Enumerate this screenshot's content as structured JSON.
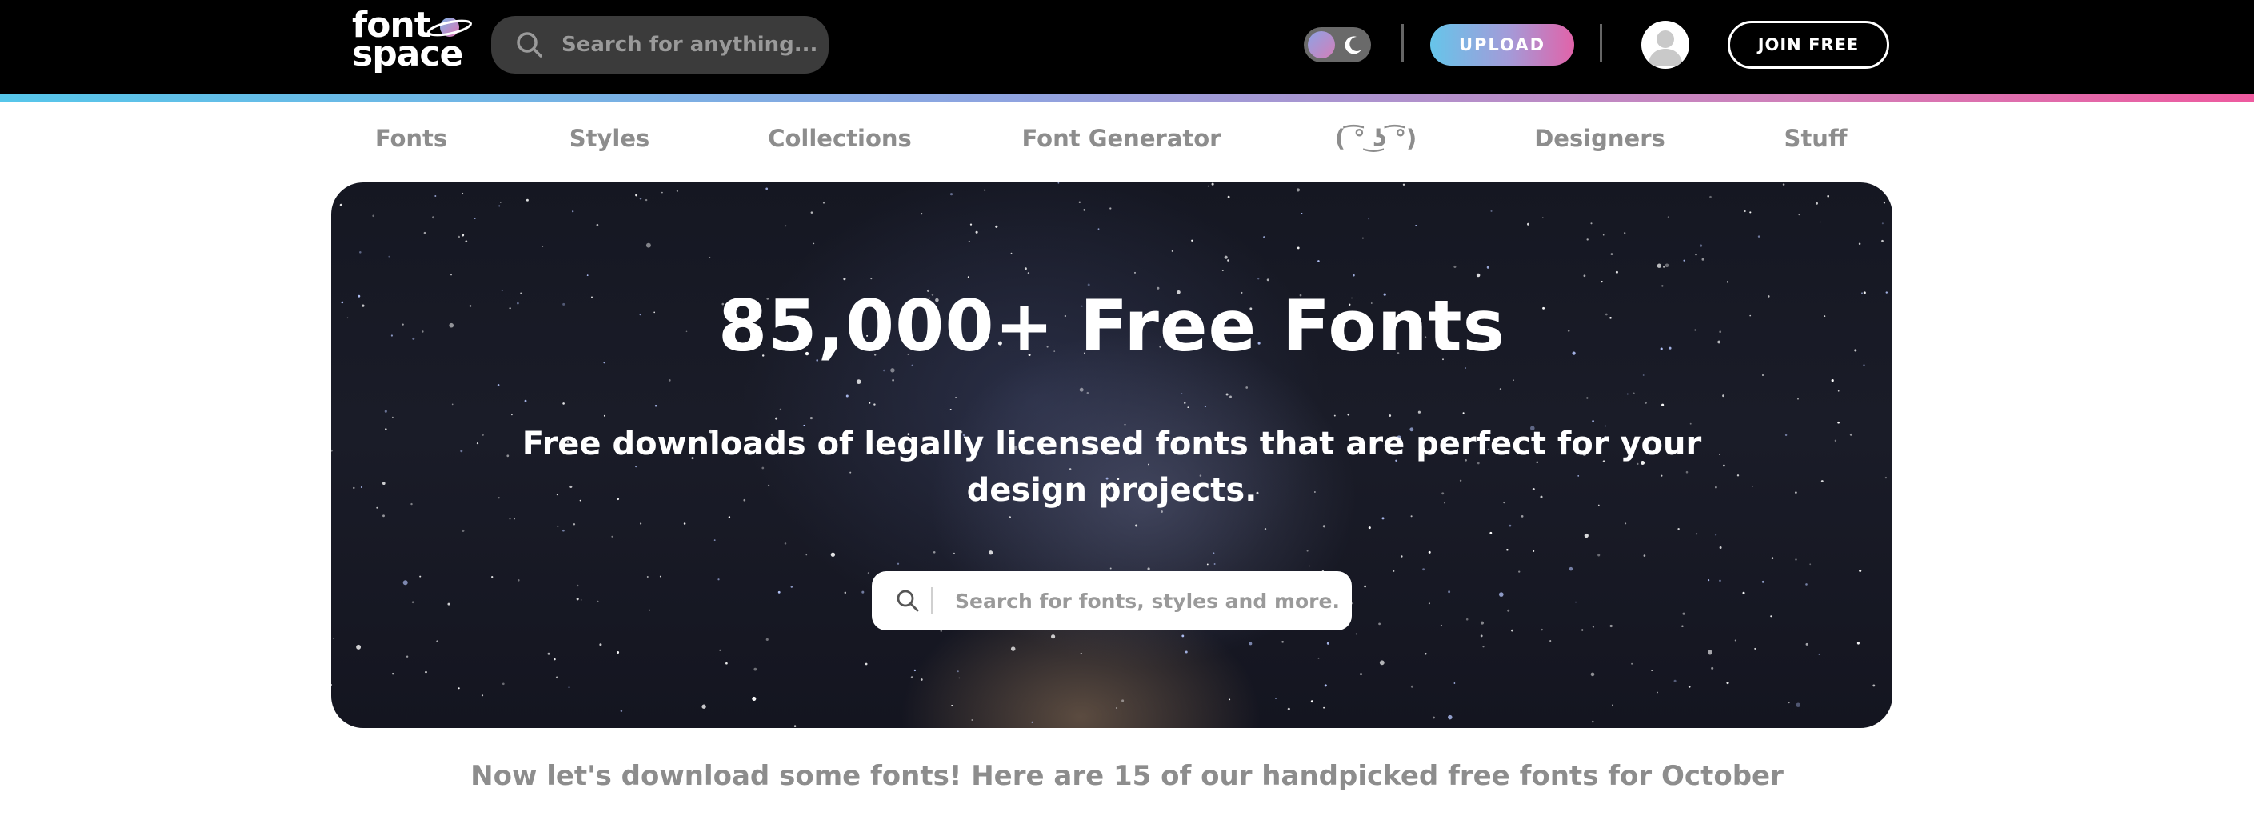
{
  "header": {
    "logo": {
      "line1": "font",
      "line2": "space",
      "icon": "planet-icon"
    },
    "search": {
      "placeholder": "Search for anything...",
      "icon": "search-icon"
    },
    "theme_toggle": {
      "icon": "moon-icon"
    },
    "upload_label": "UPLOAD",
    "avatar_icon": "user-avatar-icon",
    "join_label": "JOIN FREE"
  },
  "nav": {
    "items": [
      {
        "label": "Fonts"
      },
      {
        "label": "Styles"
      },
      {
        "label": "Collections"
      },
      {
        "label": "Font Generator"
      },
      {
        "label": "( ͡° ͜ʖ ͡°)"
      },
      {
        "label": "Designers"
      },
      {
        "label": "Stuff"
      }
    ]
  },
  "hero": {
    "title": "85,000+ Free Fonts",
    "subtitle_line1": "Free downloads of legally licensed fonts that are perfect for your",
    "subtitle_line2": "design projects.",
    "search": {
      "placeholder": "Search for fonts, styles and more.",
      "icon": "search-icon"
    }
  },
  "tagline": "Now let's download some fonts! Here are 15 of our handpicked free fonts for October",
  "colors": {
    "topbar": "#000000",
    "accent_blue": "#56c6ea",
    "accent_pink": "#ee5a9f",
    "nav_text": "#8d8d8d"
  }
}
